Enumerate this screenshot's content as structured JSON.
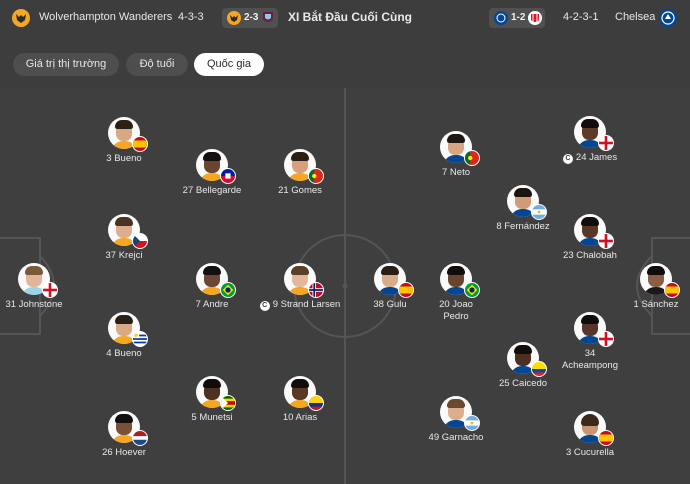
{
  "header": {
    "home_team": "Wolverhampton Wanderers",
    "home_formation": "4-3-3",
    "home_prev_score": "2-3",
    "title": "XI Bắt Đầu Cuối Cùng",
    "away_prev_score": "1-2",
    "away_formation": "4-2-3-1",
    "away_team": "Chelsea",
    "colors": {
      "wolves": "#f5a623",
      "chelsea": "#034694",
      "burnley": "#6c1d45",
      "sunderland": "#d71920"
    }
  },
  "tabs": [
    {
      "label": "Giá trị thị trường",
      "active": false
    },
    {
      "label": "Độ tuổi",
      "active": false
    },
    {
      "label": "Quốc gia",
      "active": true
    }
  ],
  "players": [
    {
      "label": "3 Bueno",
      "flag": "spain-flag"
    },
    {
      "label": "27 Bellegarde",
      "flag": "haiti-flag"
    },
    {
      "label": "21 Gomes",
      "flag": "portugal-flag"
    },
    {
      "label": "37 Krejci",
      "flag": "czech-flag"
    },
    {
      "label": "31 Johnstone",
      "flag": "england-flag"
    },
    {
      "label": "7 Andre",
      "flag": "brazil-flag"
    },
    {
      "label": "9 Strand Larsen",
      "flag": "norway-flag",
      "captain": "C"
    },
    {
      "label": "4 Bueno",
      "flag": "uruguay-flag"
    },
    {
      "label": "5 Munetsi",
      "flag": "zimbabwe-flag"
    },
    {
      "label": "10 Arias",
      "flag": "colombia-flag"
    },
    {
      "label": "26 Hoever",
      "flag": "netherlands-flag"
    },
    {
      "label": "7 Neto",
      "flag": "portugal-flag"
    },
    {
      "label": "24 James",
      "flag": "england-flag",
      "captain": "C"
    },
    {
      "label": "8 Fernández",
      "flag": "argentina-flag"
    },
    {
      "label": "23 Chalobah",
      "flag": "england-flag"
    },
    {
      "label": "38 Gulu",
      "flag": "spain-flag"
    },
    {
      "label": "20 Joao",
      "label2": "Pedro",
      "flag": "brazil-flag"
    },
    {
      "label": "1 Sánchez",
      "flag": "spain-flag"
    },
    {
      "label": "34",
      "label2": "Acheampong",
      "flag": "england-flag"
    },
    {
      "label": "25 Caicedo",
      "flag": "ecuador-flag"
    },
    {
      "label": "49 Garnacho",
      "flag": "argentina-flag"
    },
    {
      "label": "3 Cucurella",
      "flag": "spain-flag"
    }
  ]
}
